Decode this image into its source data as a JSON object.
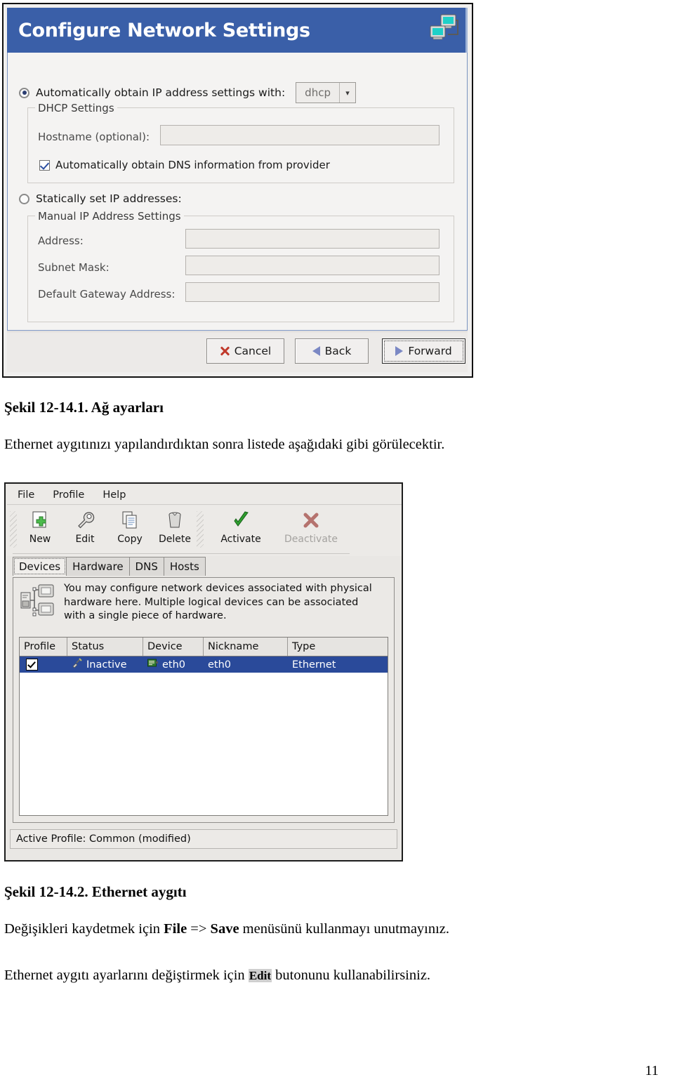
{
  "figure1": {
    "title": "Configure Network Settings",
    "title_icon": "network-computers-icon",
    "auto_radio_label_pre": "Automatically obtain ",
    "auto_radio_label": "Automatically obtain IP address settings with:",
    "combo_value": "dhcp",
    "dhcp_group_title": "DHCP Settings",
    "hostname_label": "Hostname (optional):",
    "hostname_value": "",
    "dns_checkbox_label": "Automatically obtain DNS information from provider",
    "dns_checkbox_checked": true,
    "static_radio_label": "Statically set IP addresses:",
    "manual_group_title": "Manual IP Address Settings",
    "address_label": "Address:",
    "address_value": "",
    "subnet_label": "Subnet Mask:",
    "subnet_value": "",
    "gateway_label": "Default Gateway Address:",
    "gateway_value": "",
    "buttons": {
      "cancel": "Cancel",
      "back": "Back",
      "forward": "Forward"
    }
  },
  "doc": {
    "caption1": "Şekil 12-14.1. Ağ ayarları",
    "para1": "Ethernet aygıtınızı yapılandırdıktan sonra listede aşağıdaki gibi görülecektir.",
    "caption2": "Şekil 12-14.2. Ethernet aygıtı",
    "para2_a": "Değişikleri kaydetmek için ",
    "para2_b": "File",
    "para2_c": " => ",
    "para2_d": "Save",
    "para2_e": " menüsünü kullanmayı unutmayınız.",
    "para3_a": "Ethernet aygıtı ayarlarını değiştirmek için ",
    "para3_b": "Edit",
    "para3_c": " butonunu kullanabilirsiniz.",
    "page_number": "11"
  },
  "figure2": {
    "menu": [
      "File",
      "Profile",
      "Help"
    ],
    "toolbar": [
      {
        "label": "New",
        "icon": "new-document-icon",
        "enabled": true
      },
      {
        "label": "Edit",
        "icon": "wrench-icon",
        "enabled": true
      },
      {
        "label": "Copy",
        "icon": "copy-pages-icon",
        "enabled": true
      },
      {
        "label": "Delete",
        "icon": "trash-can-icon",
        "enabled": true
      },
      {
        "label": "Activate",
        "icon": "green-check-icon",
        "enabled": true
      },
      {
        "label": "Deactivate",
        "icon": "red-x-icon",
        "enabled": false
      }
    ],
    "tabs": [
      "Devices",
      "Hardware",
      "DNS",
      "Hosts"
    ],
    "active_tab": "Devices",
    "info_icon": "network-devices-icon",
    "info_text": "You may configure network devices associated with physical hardware here.  Multiple logical devices can be associated with a single piece of hardware.",
    "table": {
      "columns": [
        "Profile",
        "Status",
        "Device",
        "Nickname",
        "Type"
      ],
      "rows": [
        {
          "profile_checked": true,
          "status": "Inactive",
          "status_icon": "unplugged-connector-icon",
          "device": "eth0",
          "device_icon": "nic-card-icon",
          "nickname": "eth0",
          "type": "Ethernet",
          "selected": true
        }
      ]
    },
    "statusbar": "Active Profile: Common (modified)"
  },
  "colors": {
    "titlebar": "#3a5fa8",
    "selection": "#2a4a9a",
    "accent_green": "#2f9e2f",
    "accent_red": "#c0392b"
  }
}
